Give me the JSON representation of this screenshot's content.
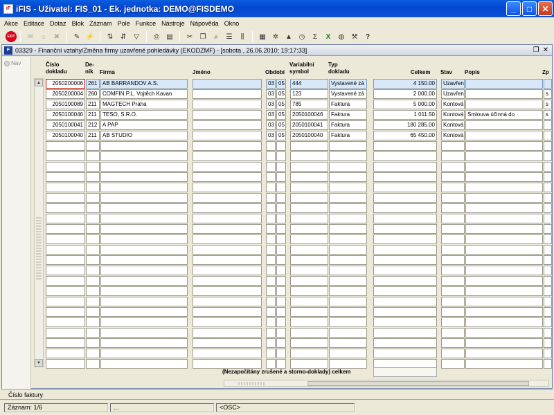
{
  "window": {
    "title": "iFIS - Uživatel: FIS_01 - Ek. jednotka: DEMO@FISDEMO",
    "app_icon": "ifis-app-icon"
  },
  "menu": [
    "Akce",
    "Editace",
    "Dotaz",
    "Blok",
    "Záznam",
    "Pole",
    "Funkce",
    "Nástroje",
    "Nápověda",
    "Okno"
  ],
  "toolbar": {
    "exit_label": "EXIT"
  },
  "form": {
    "title": "03329 - Finanční vztahy/Změna firmy uzavřené pohledávky (EKODZMF) - [sobota , 26.06.2010; 19:17:33]",
    "nav_label": "Nav",
    "headers": {
      "cislo": "Číslo dokladu",
      "denik": "De-ník",
      "firma": "Firma",
      "jmeno": "Jméno",
      "obdobi": "Období",
      "varsym": "Variabilní symbol",
      "typ": "Typ dokladu",
      "celkem": "Celkem",
      "stav": "Stav",
      "popis": "Popis",
      "zp": "Zp"
    },
    "rows": [
      {
        "cislo": "2050200006",
        "denik": "261",
        "firma": "AB BARRANDOV A.S.",
        "jmeno": "",
        "o1": "03",
        "o2": "05",
        "varsym": "444",
        "typ": "Vystavené zá",
        "celkem": "4 150.00",
        "stav": "Uzavřen",
        "popis": "",
        "zp": ""
      },
      {
        "cislo": "2050200004",
        "denik": "260",
        "firma": "COMFIN P.L. Vojtěch Kavan",
        "jmeno": "",
        "o1": "03",
        "o2": "05",
        "varsym": "123",
        "typ": "Vystavené zá",
        "celkem": "2 000.00",
        "stav": "Uzavřen",
        "popis": "",
        "zp": "s"
      },
      {
        "cislo": "2050100089",
        "denik": "211",
        "firma": "MAGTECH Praha",
        "jmeno": "",
        "o1": "03",
        "o2": "05",
        "varsym": "785",
        "typ": "Faktura",
        "celkem": "5 000.00",
        "stav": "Kontová",
        "popis": "",
        "zp": "s"
      },
      {
        "cislo": "2050100046",
        "denik": "211",
        "firma": "TESO, S.R.O.",
        "jmeno": "",
        "o1": "03",
        "o2": "05",
        "varsym": "2050100046",
        "typ": "Faktura",
        "celkem": "1 011.50",
        "stav": "Kontová",
        "popis": "Smlouva účinná do",
        "zp": "s"
      },
      {
        "cislo": "2050100041",
        "denik": "212",
        "firma": "A PAP",
        "jmeno": "",
        "o1": "03",
        "o2": "05",
        "varsym": "2050100041",
        "typ": "Faktura",
        "celkem": "180 285.00",
        "stav": "Kontová",
        "popis": "",
        "zp": ""
      },
      {
        "cislo": "2050100040",
        "denik": "211",
        "firma": "AB STUDIO",
        "jmeno": "",
        "o1": "03",
        "o2": "05",
        "varsym": "2050100040",
        "typ": "Faktura",
        "celkem": "65 450.00",
        "stav": "Kontová",
        "popis": "",
        "zp": ""
      }
    ],
    "total_label": "(Nezapočítány zrušené a storno-doklady) celkem"
  },
  "hint": "Číslo faktury",
  "status": {
    "record": "Záznam: 1/6",
    "seg2": "...",
    "seg3": "<OSC>"
  }
}
